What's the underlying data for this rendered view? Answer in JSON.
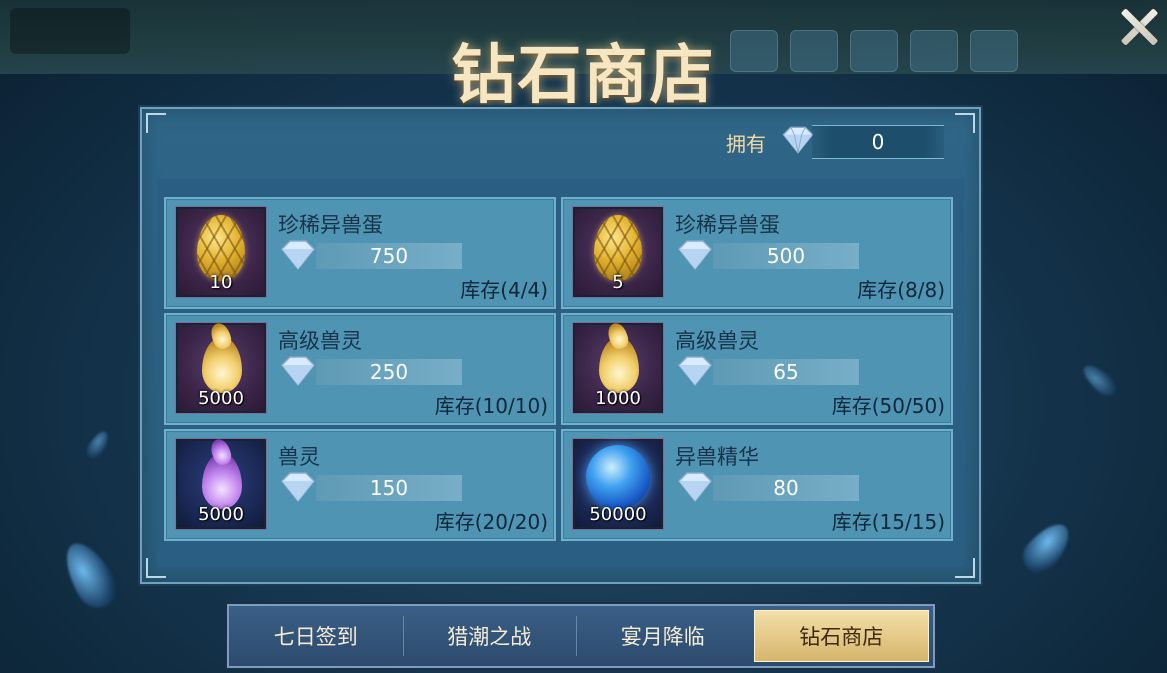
{
  "title": "钻石商店",
  "owned": {
    "label": "拥有",
    "value": "0",
    "icon": "diamond-icon"
  },
  "items": [
    {
      "name": "珍稀异兽蛋",
      "qty": "10",
      "price": "750",
      "stock": "库存(4/4)",
      "icon": "golden-egg-icon"
    },
    {
      "name": "珍稀异兽蛋",
      "qty": "5",
      "price": "500",
      "stock": "库存(8/8)",
      "icon": "golden-egg-icon"
    },
    {
      "name": "高级兽灵",
      "qty": "5000",
      "price": "250",
      "stock": "库存(10/10)",
      "icon": "golden-flame-icon"
    },
    {
      "name": "高级兽灵",
      "qty": "1000",
      "price": "65",
      "stock": "库存(50/50)",
      "icon": "golden-flame-icon"
    },
    {
      "name": "兽灵",
      "qty": "5000",
      "price": "150",
      "stock": "库存(20/20)",
      "icon": "purple-flame-icon"
    },
    {
      "name": "异兽精华",
      "qty": "50000",
      "price": "80",
      "stock": "库存(15/15)",
      "icon": "blue-orb-icon"
    }
  ],
  "tabs": [
    {
      "label": "七日签到",
      "active": false
    },
    {
      "label": "猎潮之战",
      "active": false
    },
    {
      "label": "宴月降临",
      "active": false
    },
    {
      "label": "钻石商店",
      "active": true
    }
  ],
  "colors": {
    "title": "#f6e6c2",
    "panel": "#2f6687",
    "card": "#4f95b3",
    "active_tab": "#e6c98a"
  }
}
